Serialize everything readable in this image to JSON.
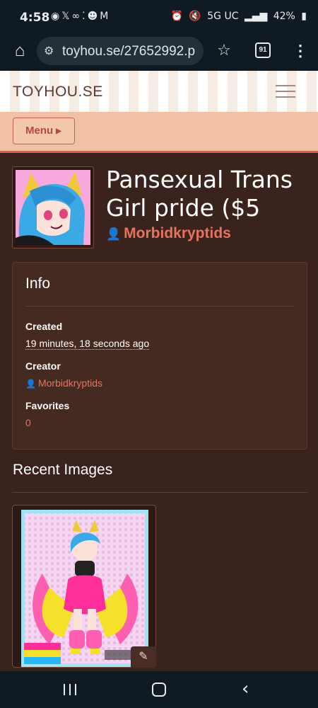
{
  "status_bar": {
    "time": "4:58",
    "notification_icons": [
      "chat-bubble-icon",
      "x-icon",
      "voicemail-icon",
      "sparkles-icon",
      "bear-icon",
      "gmail-icon"
    ],
    "network": "5G UC",
    "battery": "42%"
  },
  "browser": {
    "url": "toyhou.se/27652992.p",
    "tab_count": "91"
  },
  "site": {
    "logo": "TOYHOU.SE",
    "menu_label": "Menu"
  },
  "character": {
    "name": "Pansexual Trans Girl pride ($5",
    "creator": "Morbidkryptids"
  },
  "info": {
    "heading": "Info",
    "fields": [
      {
        "label": "Created",
        "value": "19 minutes, 18 seconds ago"
      },
      {
        "label": "Creator",
        "value": "Morbidkryptids"
      },
      {
        "label": "Favorites",
        "value": "0"
      }
    ]
  },
  "recent_images": {
    "heading": "Recent Images"
  },
  "colors": {
    "page_bg": "#3b231d",
    "card_bg": "#452a22",
    "accent": "#e6735e",
    "menu_strip": "#f0c1a3",
    "chrome_bg": "#0f1a22"
  }
}
